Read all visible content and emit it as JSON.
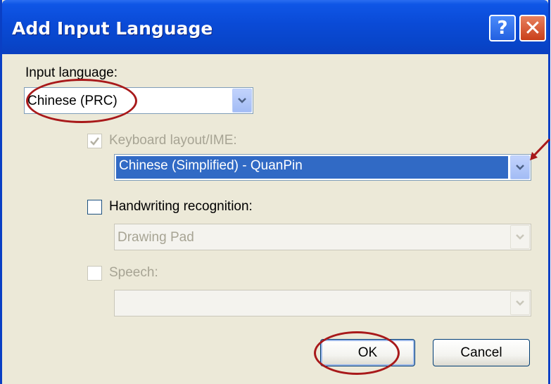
{
  "window": {
    "title": "Add Input Language",
    "help_glyph": "?",
    "close_glyph": "✕"
  },
  "input_language": {
    "label": "Input language:",
    "selected": "Chinese (PRC)"
  },
  "keyboard_layout": {
    "label": "Keyboard layout/IME:",
    "checked": true,
    "enabled": false,
    "selected": "Chinese (Simplified) - QuanPin"
  },
  "handwriting": {
    "label": "Handwriting recognition:",
    "checked": false,
    "selected": "Drawing Pad",
    "enabled": false
  },
  "speech": {
    "label": "Speech:",
    "checked": false,
    "enabled": false,
    "selected": ""
  },
  "buttons": {
    "ok": "OK",
    "cancel": "Cancel"
  },
  "annotation_color": "#a8191a"
}
